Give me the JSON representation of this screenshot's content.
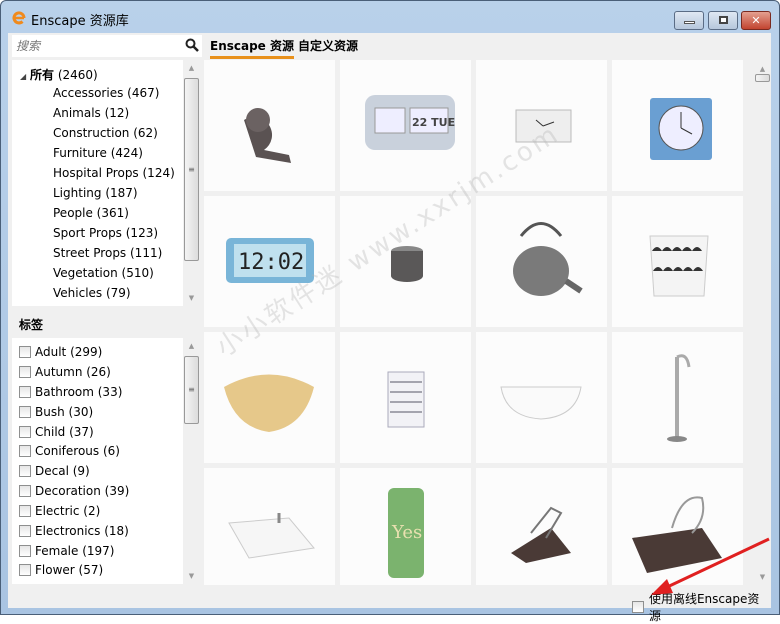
{
  "window": {
    "title": "Enscape 资源库",
    "icon": "enscape-logo-icon",
    "controls": [
      "minimize",
      "maximize",
      "close"
    ]
  },
  "search": {
    "placeholder": "搜索",
    "value": ""
  },
  "tabs": [
    {
      "label": "Enscape 资源",
      "active": true
    },
    {
      "label": "自定义资源",
      "active": false
    }
  ],
  "categories": {
    "root": {
      "label": "所有",
      "count": "(2460)",
      "expanded": true
    },
    "items": [
      {
        "label": "Accessories (467)"
      },
      {
        "label": "Animals (12)"
      },
      {
        "label": "Construction (62)"
      },
      {
        "label": "Furniture (424)"
      },
      {
        "label": "Hospital Props (124)"
      },
      {
        "label": "Lighting (187)"
      },
      {
        "label": "People (361)"
      },
      {
        "label": "Sport Props (123)"
      },
      {
        "label": "Street Props (111)"
      },
      {
        "label": "Vegetation (510)"
      },
      {
        "label": "Vehicles (79)"
      }
    ]
  },
  "tags": {
    "heading": "标签",
    "items": [
      {
        "label": "Adult (299)",
        "checked": false
      },
      {
        "label": "Autumn (26)",
        "checked": false
      },
      {
        "label": "Bathroom (33)",
        "checked": false
      },
      {
        "label": "Bush (30)",
        "checked": false
      },
      {
        "label": "Child (37)",
        "checked": false
      },
      {
        "label": "Coniferous (6)",
        "checked": false
      },
      {
        "label": "Decal (9)",
        "checked": false
      },
      {
        "label": "Decoration (39)",
        "checked": false
      },
      {
        "label": "Electric (2)",
        "checked": false
      },
      {
        "label": "Electronics (18)",
        "checked": false
      },
      {
        "label": "Female (197)",
        "checked": false
      },
      {
        "label": "Flower (57)",
        "checked": false
      }
    ]
  },
  "assets": [
    {
      "name": "tape-dispenser"
    },
    {
      "name": "flip-clock-22-tue",
      "clock_text": "22 TUE"
    },
    {
      "name": "white-desk-clock"
    },
    {
      "name": "blue-alarm-clock"
    },
    {
      "name": "digital-clock",
      "clock_text": "12:02"
    },
    {
      "name": "metal-cup"
    },
    {
      "name": "teapot"
    },
    {
      "name": "patterned-basket"
    },
    {
      "name": "woven-basket"
    },
    {
      "name": "folded-towel"
    },
    {
      "name": "bathtub"
    },
    {
      "name": "shower-tap"
    },
    {
      "name": "sink"
    },
    {
      "name": "drink-can",
      "can_text": "Yes"
    },
    {
      "name": "binder-clip-small"
    },
    {
      "name": "binder-clip-large"
    }
  ],
  "footer": {
    "offline_label": "使用离线Enscape资源",
    "offline_checked": false
  },
  "watermark": "小小软件迷 www.xxrjm.com",
  "colors": {
    "accent": "#e8901a",
    "close_button": "#c24430",
    "annotation_arrow": "#e02020"
  }
}
